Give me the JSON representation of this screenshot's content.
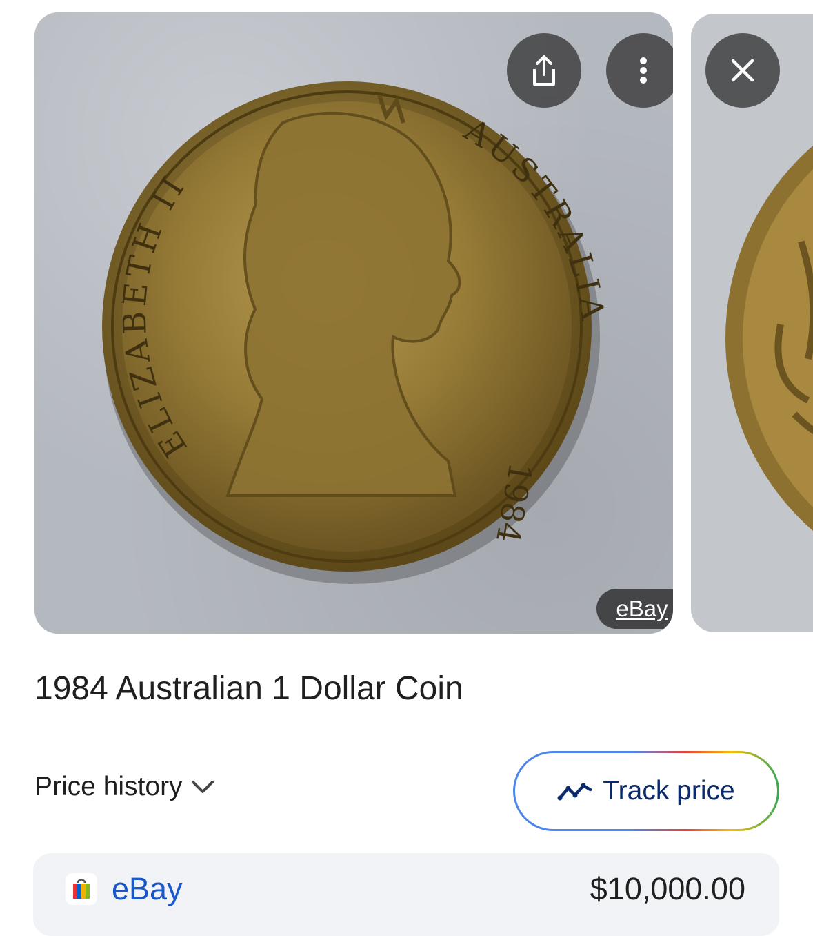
{
  "image": {
    "coin_obverse_text": [
      "ELIZABETH II",
      "AUSTRALIA",
      "1984"
    ],
    "source_badge": "eBay"
  },
  "actions": {
    "share_icon": "share-icon",
    "more_icon": "more-vert-icon",
    "close_icon": "close-icon"
  },
  "product": {
    "title": "1984 Australian 1 Dollar Coin"
  },
  "price_history": {
    "label": "Price history"
  },
  "track_price": {
    "label": "Track price"
  },
  "offers": [
    {
      "seller": "eBay",
      "price": "$10,000.00"
    }
  ],
  "colors": {
    "link_blue": "#1a57c9",
    "track_text": "#0b2a6b",
    "overlay": "#3c3c3c"
  }
}
